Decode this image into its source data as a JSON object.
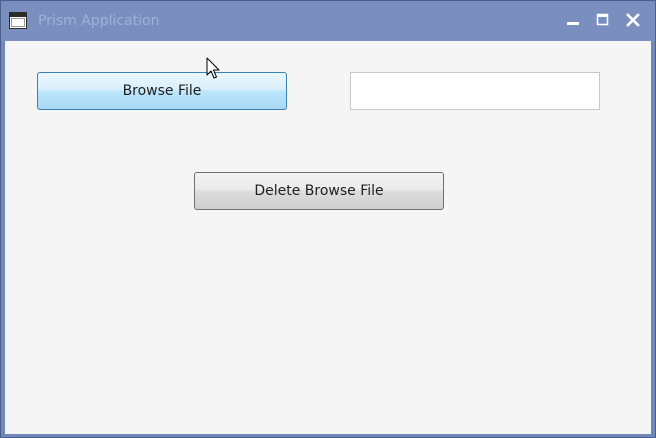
{
  "window": {
    "title": "Prism Application",
    "icons": {
      "app": "application-window-icon",
      "minimize": "minimize-icon",
      "maximize": "maximize-icon",
      "close": "close-icon"
    }
  },
  "main": {
    "browse_button_label": "Browse File",
    "file_path_value": "",
    "delete_button_label": "Delete Browse File"
  },
  "colors": {
    "titlebar": "#7a8fc0",
    "client_background": "#f5f5f5",
    "browse_button_hover": "#bee6fd",
    "browse_button_border": "#3c7fb1"
  }
}
